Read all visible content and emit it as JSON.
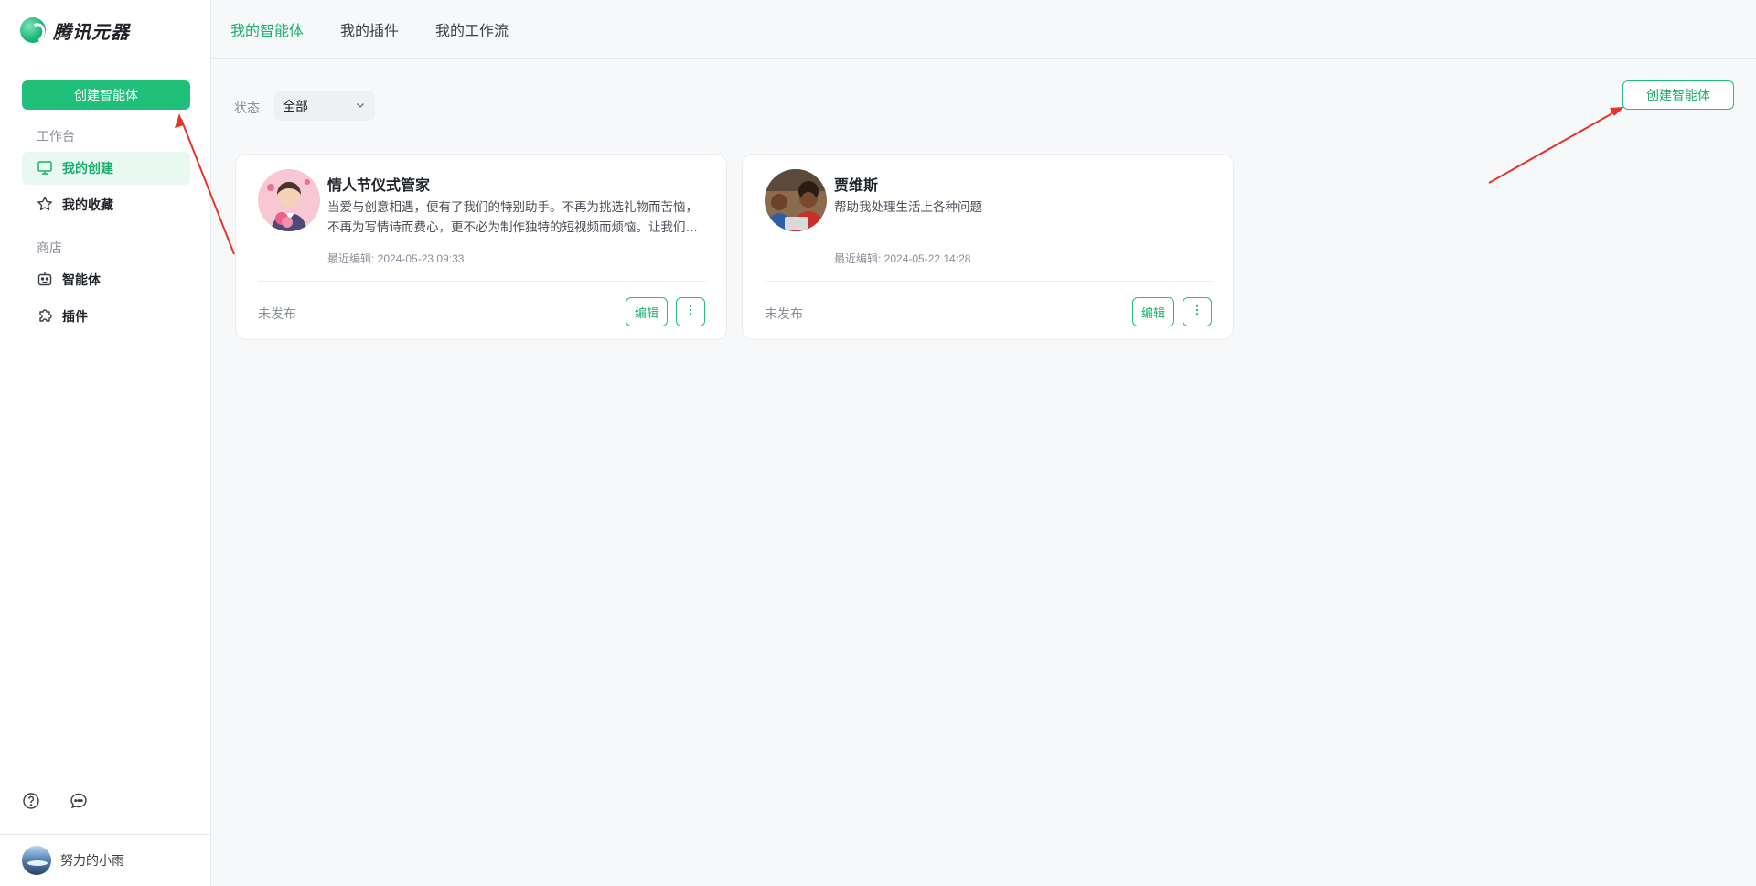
{
  "brand": {
    "name": "腾讯元器"
  },
  "sidebar": {
    "create_button": "创建智能体",
    "sections": [
      {
        "label": "工作台",
        "items": [
          {
            "label": "我的创建",
            "icon": "monitor-icon",
            "active": true
          },
          {
            "label": "我的收藏",
            "icon": "star-icon",
            "active": false
          }
        ]
      },
      {
        "label": "商店",
        "items": [
          {
            "label": "智能体",
            "icon": "robot-icon",
            "active": false
          },
          {
            "label": "插件",
            "icon": "puzzle-icon",
            "active": false
          }
        ]
      }
    ],
    "utility_icons": [
      "help-circle-icon",
      "chat-bubble-icon"
    ],
    "user": {
      "name": "努力的小雨"
    }
  },
  "topnav": {
    "tabs": [
      {
        "label": "我的智能体",
        "active": true
      },
      {
        "label": "我的插件",
        "active": false
      },
      {
        "label": "我的工作流",
        "active": false
      }
    ]
  },
  "filter": {
    "label": "状态",
    "value": "全部"
  },
  "main": {
    "create_button": "创建智能体"
  },
  "agents": [
    {
      "name": "情人节仪式管家",
      "description": "当爱与创意相遇，便有了我们的特别助手。不再为挑选礼物而苦恼，不再为写情诗而费心，更不必为制作独特的短视频而烦恼。让我们一起，为每一个浪漫时刻增添一份完美的仪式感。",
      "edited": "最近编辑: 2024-05-23 09:33",
      "status": "未发布",
      "edit_label": "编辑"
    },
    {
      "name": "贾维斯",
      "description": "帮助我处理生活上各种问题",
      "edited": "最近编辑: 2024-05-22 14:28",
      "status": "未发布",
      "edit_label": "编辑"
    }
  ],
  "colors": {
    "accent": "#20c07a",
    "accent_text": "#1aaf6c",
    "annotation": "#e8332a"
  }
}
